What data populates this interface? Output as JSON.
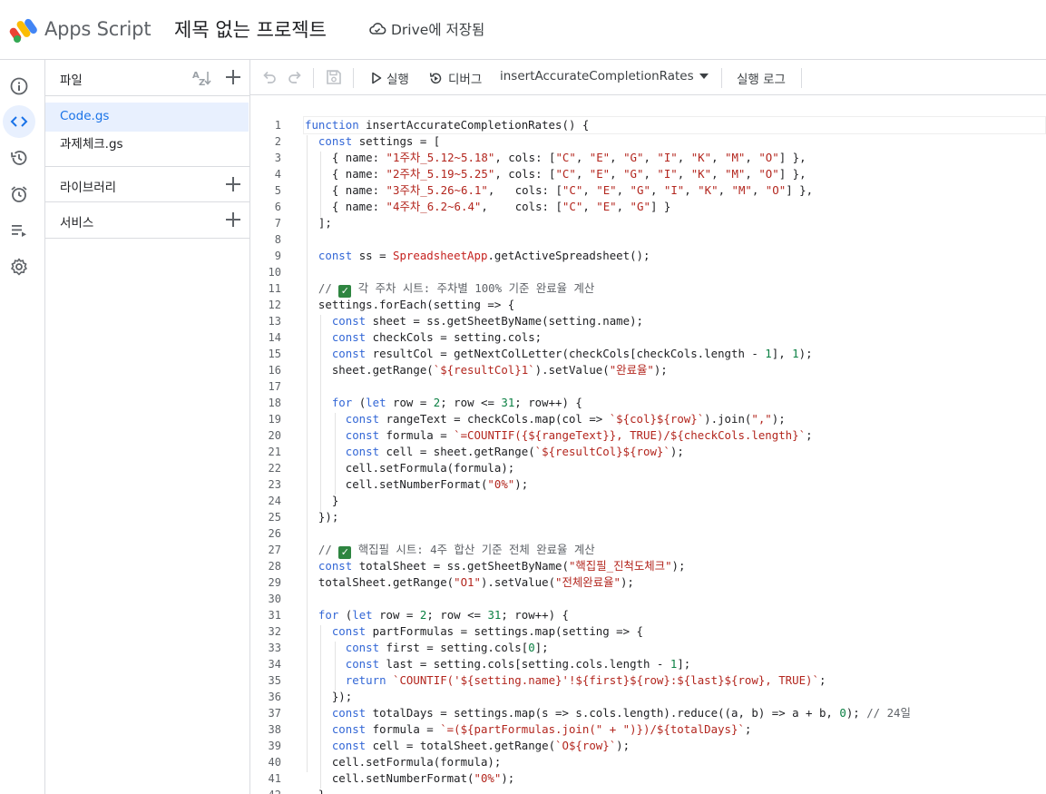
{
  "header": {
    "app_name": "Apps Script",
    "project_title": "제목 없는 프로젝트",
    "save_status": "Drive에 저장됨"
  },
  "rail": {
    "items": [
      {
        "name": "info-icon"
      },
      {
        "name": "code-icon",
        "active": true
      },
      {
        "name": "history-icon"
      },
      {
        "name": "trigger-clock-icon"
      },
      {
        "name": "executions-icon"
      },
      {
        "name": "settings-gear-icon"
      }
    ]
  },
  "files_panel": {
    "files_label": "파일",
    "files": [
      {
        "label": "Code.gs",
        "active": true
      },
      {
        "label": "과제체크.gs",
        "active": false
      }
    ],
    "libraries_label": "라이브러리",
    "services_label": "서비스"
  },
  "toolbar": {
    "run_label": "실행",
    "debug_label": "디버그",
    "function_select": "insertAccurateCompletionRates",
    "log_label": "실행 로그"
  },
  "editor": {
    "lines": [
      "function insertAccurateCompletionRates() {",
      "  const settings = [",
      "    { name: \"1주차_5.12~5.18\", cols: [\"C\", \"E\", \"G\", \"I\", \"K\", \"M\", \"O\"] },",
      "    { name: \"2주차_5.19~5.25\", cols: [\"C\", \"E\", \"G\", \"I\", \"K\", \"M\", \"O\"] },",
      "    { name: \"3주차_5.26~6.1\",   cols: [\"C\", \"E\", \"G\", \"I\", \"K\", \"M\", \"O\"] },",
      "    { name: \"4주차_6.2~6.4\",    cols: [\"C\", \"E\", \"G\"] }",
      "  ];",
      "",
      "  const ss = SpreadsheetApp.getActiveSpreadsheet();",
      "",
      "  // ✅ 각 주차 시트: 주차별 100% 기준 완료율 계산",
      "  settings.forEach(setting => {",
      "    const sheet = ss.getSheetByName(setting.name);",
      "    const checkCols = setting.cols;",
      "    const resultCol = getNextColLetter(checkCols[checkCols.length - 1], 1);",
      "    sheet.getRange(`${resultCol}1`).setValue(\"완료율\");",
      "",
      "    for (let row = 2; row <= 31; row++) {",
      "      const rangeText = checkCols.map(col => `${col}${row}`).join(\",\");",
      "      const formula = `=COUNTIF({${rangeText}}, TRUE)/${checkCols.length}`;",
      "      const cell = sheet.getRange(`${resultCol}${row}`);",
      "      cell.setFormula(formula);",
      "      cell.setNumberFormat(\"0%\");",
      "    }",
      "  });",
      "",
      "  // ✅ 핵집필 시트: 4주 합산 기준 전체 완료율 계산",
      "  const totalSheet = ss.getSheetByName(\"핵집필_진척도체크\");",
      "  totalSheet.getRange(\"O1\").setValue(\"전체완료율\");",
      "",
      "  for (let row = 2; row <= 31; row++) {",
      "    const partFormulas = settings.map(setting => {",
      "      const first = setting.cols[0];",
      "      const last = setting.cols[setting.cols.length - 1];",
      "      return `COUNTIF('${setting.name}'!${first}${row}:${last}${row}, TRUE)`;",
      "    });",
      "    const totalDays = settings.map(s => s.cols.length).reduce((a, b) => a + b, 0); // 24일",
      "    const formula = `=(${partFormulas.join(\" + \")})/${totalDays}`;",
      "    const cell = totalSheet.getRange(`O${row}`);",
      "    cell.setFormula(formula);",
      "    cell.setNumberFormat(\"0%\");",
      "  }"
    ]
  }
}
